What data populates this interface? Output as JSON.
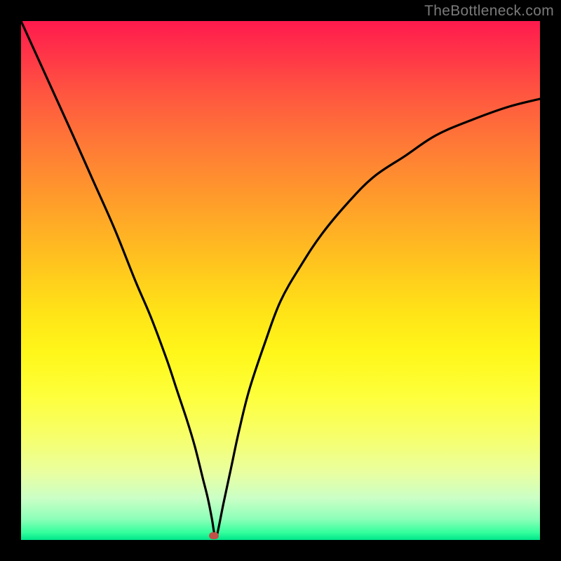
{
  "watermark": "TheBottleneck.com",
  "chart_data": {
    "type": "line",
    "title": "",
    "xlabel": "",
    "ylabel": "",
    "xlim": [
      0,
      100
    ],
    "ylim": [
      0,
      100
    ],
    "grid": false,
    "legend": false,
    "series": [
      {
        "name": "bottleneck-curve",
        "x": [
          0,
          5,
          10,
          14,
          18,
          22,
          25,
          28,
          30,
          32,
          33.5,
          35,
          36,
          36.8,
          37.2,
          37.6,
          38,
          39,
          40.5,
          42,
          44,
          47,
          50,
          54,
          58,
          63,
          68,
          74,
          80,
          87,
          94,
          100
        ],
        "y": [
          100,
          89,
          78,
          69,
          60,
          50,
          43,
          35,
          29,
          23,
          18,
          12,
          8,
          4,
          1.5,
          0.5,
          2,
          7,
          14,
          21,
          29,
          38,
          46,
          53,
          59,
          65,
          70,
          74,
          78,
          81,
          83.5,
          85
        ]
      }
    ],
    "marker": {
      "x": 37.2,
      "y": 0.8,
      "color": "#c05048"
    },
    "gradient_stops": [
      {
        "pos": 0,
        "color": "#ff1a4d"
      },
      {
        "pos": 0.35,
        "color": "#ff9e2a"
      },
      {
        "pos": 0.64,
        "color": "#fff71a"
      },
      {
        "pos": 0.96,
        "color": "#8cffb8"
      },
      {
        "pos": 1.0,
        "color": "#00e68a"
      }
    ]
  }
}
